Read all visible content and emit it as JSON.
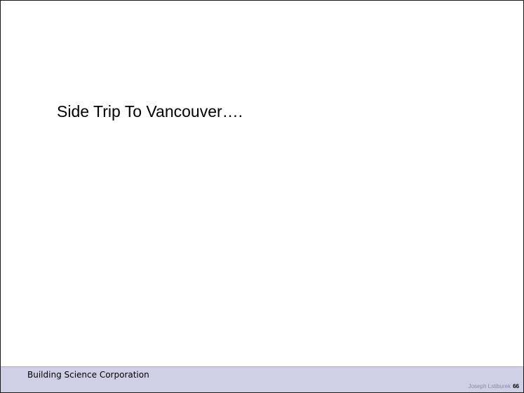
{
  "slide": {
    "title": "Side Trip To Vancouver…."
  },
  "footer": {
    "organization": "Building Science Corporation",
    "author": "Joseph Lstiburek",
    "page_number": "66"
  },
  "colors": {
    "footer_background": "#cfcfe6",
    "footer_author_text": "#8a8aa8",
    "slide_border": "#1a1a1a"
  }
}
